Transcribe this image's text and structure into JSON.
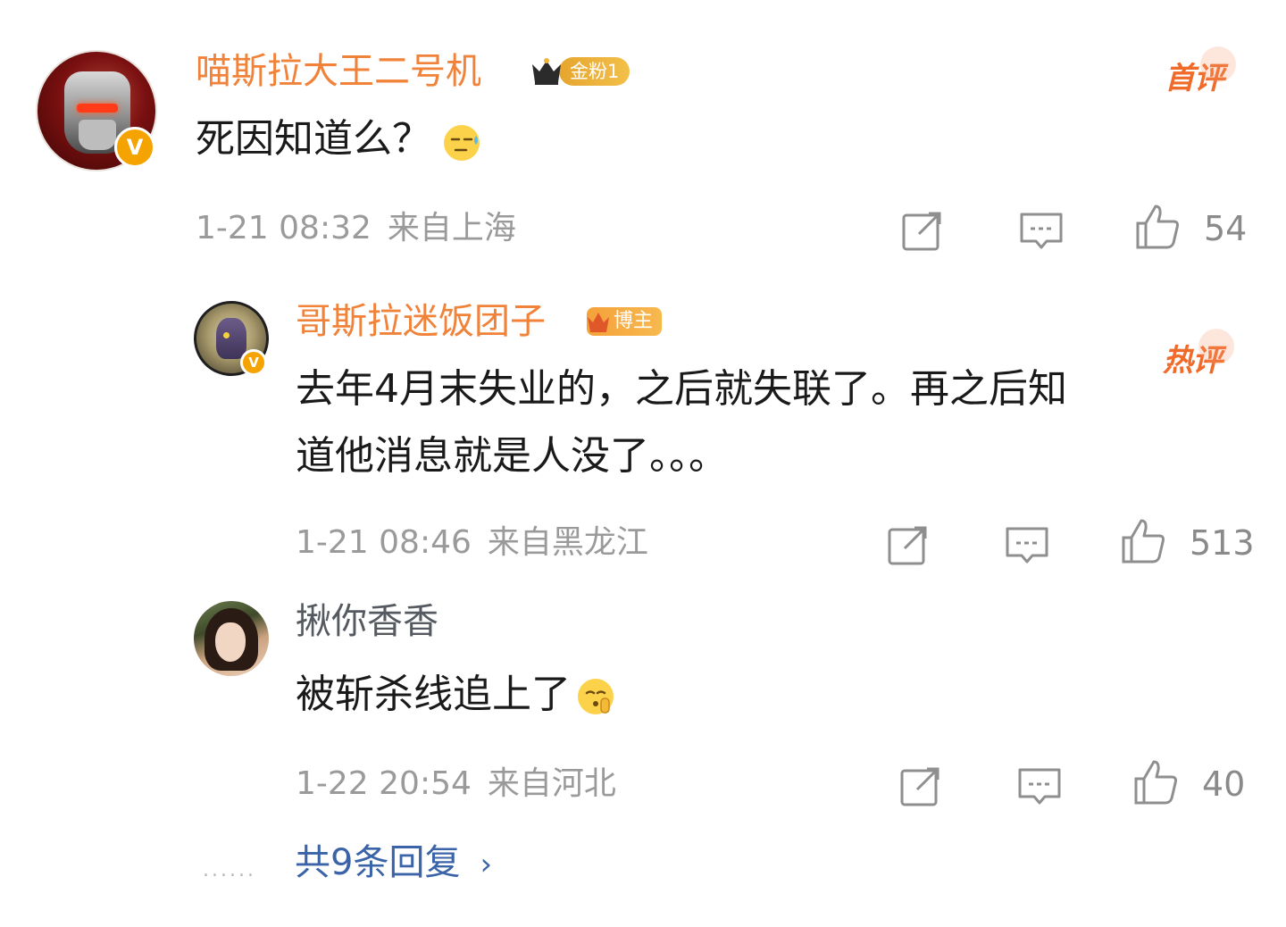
{
  "comment": {
    "username": "喵斯拉大王二号机",
    "fan_badge": "金粉1",
    "tag": "首评",
    "text": "死因知道么？",
    "emoji": "sweat-face",
    "time": "1-21 08:32",
    "location": "来自上海",
    "likes": "54"
  },
  "replies": [
    {
      "username": "哥斯拉迷饭团子",
      "badge": "博主",
      "tag": "热评",
      "text_line1": "去年4月末失业的，之后就失联了。再之后知",
      "text_line2": "道他消息就是人没了。。。",
      "time": "1-21 08:46",
      "location": "来自黑龙江",
      "likes": "513"
    },
    {
      "username": "揪你香香",
      "text": "被斩杀线追上了",
      "emoji": "shushing-face",
      "time": "1-22 20:54",
      "location": "来自河北",
      "likes": "40"
    }
  ],
  "footer": {
    "dots": "......",
    "more_replies": "共9条回复",
    "chevron": "›"
  },
  "colors": {
    "username": "#f0823a",
    "link": "#3b63a8",
    "meta": "#9a9a9a",
    "badge_gold": "#f2b33c"
  },
  "icons": [
    "share-icon",
    "comment-icon",
    "like-icon"
  ]
}
